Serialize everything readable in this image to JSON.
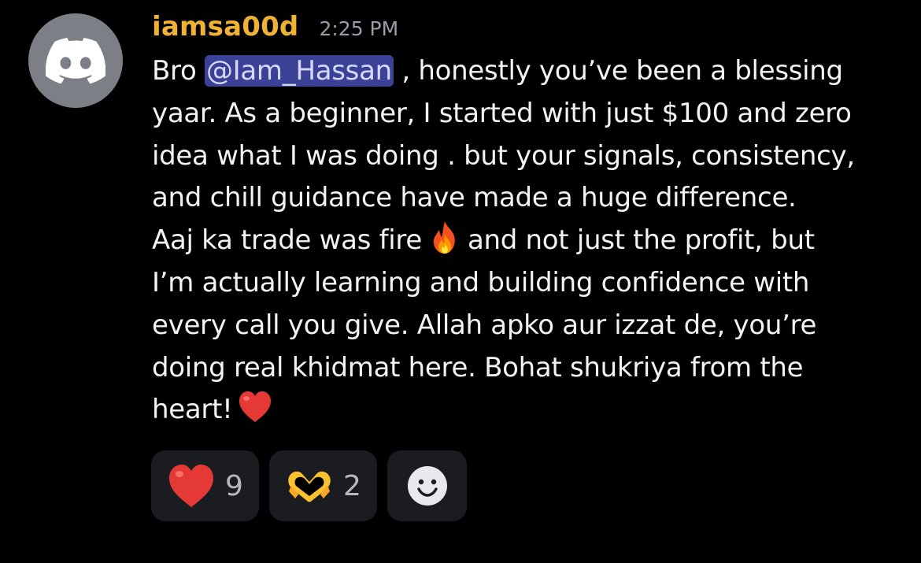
{
  "author": {
    "username": "iamsa00d",
    "timestamp": "2:25 PM",
    "avatar_icon": "discord-logo-icon",
    "username_color": "#f0b232"
  },
  "message": {
    "line1_before": "Bro ",
    "mention": "@Iam_Hassan",
    "line1_after": " , honestly you’ve been a blessing",
    "line2": "yaar. As a beginner, I started with just $100 and zero",
    "line3": "idea what I was doing . but your signals, consistency,",
    "line4": "and chill guidance have made a huge difference.",
    "line5_before": "Aaj ka trade was fire",
    "line5_emoji": "fire-emoji",
    "line5_after": "and not just the profit, but",
    "line6": "I’m actually learning and building confidence with",
    "line7": "every call you give. Allah apko aur izzat de, you’re",
    "line8": "doing real khidmat here. Bohat shukriya from the",
    "line9": "heart!",
    "line9_emoji": "red-heart-emoji"
  },
  "reactions": [
    {
      "emoji": "red-heart-emoji",
      "count": "9"
    },
    {
      "emoji": "heart-hands-emoji",
      "count": "2"
    }
  ],
  "add_reaction_icon": "smiley-add-reaction-icon"
}
